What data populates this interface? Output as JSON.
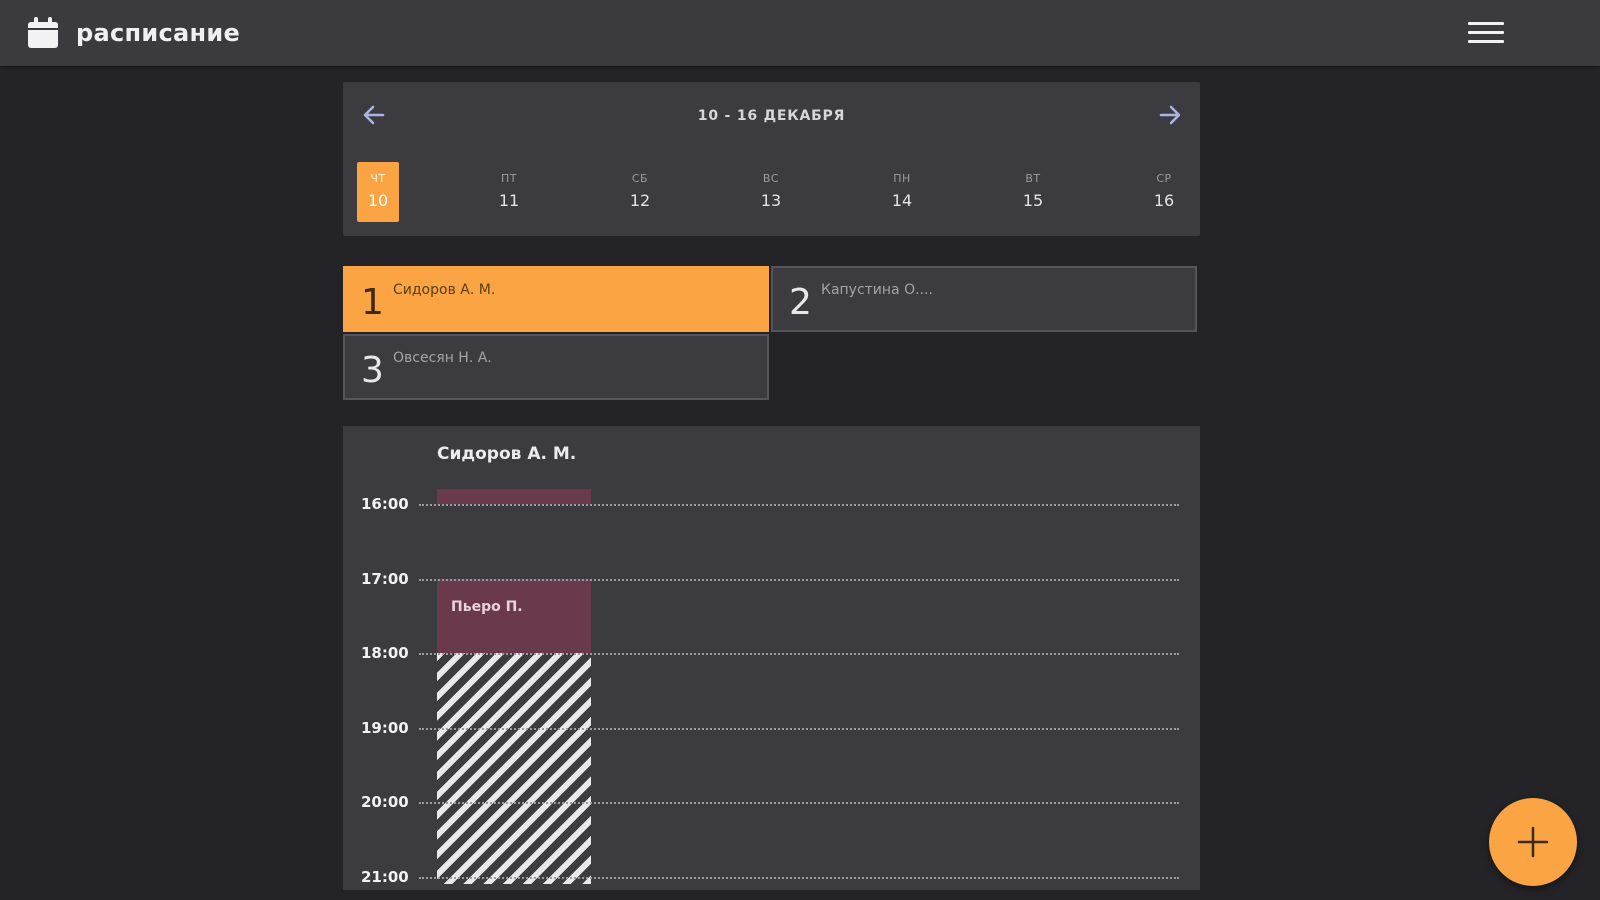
{
  "app": {
    "title": "расписание",
    "icon": "calendar-icon",
    "menu_icon": "hamburger-menu-icon"
  },
  "week": {
    "range_label": "10 - 16 ДЕКАБРЯ",
    "prev_icon": "arrow-left-icon",
    "next_icon": "arrow-right-icon",
    "selected_index": 0,
    "days": [
      {
        "dow": "ЧТ",
        "num": "10"
      },
      {
        "dow": "ПТ",
        "num": "11"
      },
      {
        "dow": "СБ",
        "num": "12"
      },
      {
        "dow": "ВС",
        "num": "13"
      },
      {
        "dow": "ПН",
        "num": "14"
      },
      {
        "dow": "ВТ",
        "num": "15"
      },
      {
        "dow": "СР",
        "num": "16"
      }
    ]
  },
  "teachers": {
    "active_index": 0,
    "items": [
      {
        "num": "1",
        "name": "Сидоров А. М."
      },
      {
        "num": "2",
        "name": "Капустина О...."
      },
      {
        "num": "3",
        "name": "Овсесян Н. А."
      }
    ]
  },
  "schedule": {
    "teacher_name": "Сидоров А. М.",
    "hours": [
      "16:00",
      "17:00",
      "18:00",
      "19:00",
      "20:00",
      "21:00"
    ],
    "booked": [
      {
        "label": "",
        "start_hour": 15.8,
        "end_hour": 16.0
      },
      {
        "label": "Пьеро П.",
        "start_hour": 17.0,
        "end_hour": 18.0
      }
    ],
    "unavailable": {
      "start_hour": 18.0,
      "end_hour": 21.1
    }
  },
  "fab": {
    "icon": "plus-icon"
  },
  "colors": {
    "accent": "#fba443",
    "booked": "#6a3a4c",
    "background": "#242428",
    "panel": "#3b3b40"
  }
}
